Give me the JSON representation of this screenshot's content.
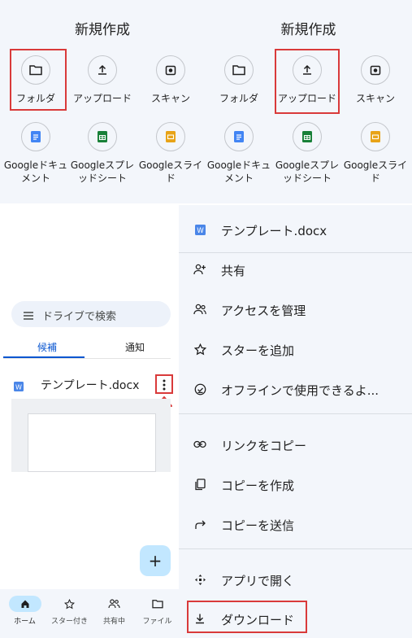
{
  "new_sheet": {
    "title": "新規作成",
    "options": [
      {
        "label": "フォルダ",
        "icon": "folder-icon"
      },
      {
        "label": "アップロード",
        "icon": "upload-icon"
      },
      {
        "label": "スキャン",
        "icon": "camera-icon"
      },
      {
        "label": "Googleドキュメント",
        "line1": "Googleドキュ",
        "line2": "メント",
        "icon": "google-docs-icon",
        "color": "#4285f4"
      },
      {
        "label": "Googleスプレッドシート",
        "line1": "Googleスプレ",
        "line2": "ッドシート",
        "icon": "google-sheets-icon",
        "color": "#188038"
      },
      {
        "label": "Googleスライド",
        "line1": "Googleスライ",
        "line2": "ド",
        "icon": "google-slides-icon",
        "color": "#e8a317"
      }
    ],
    "highlight_left": "フォルダ",
    "highlight_right": "アップロード"
  },
  "home": {
    "search_placeholder": "ドライブで検索",
    "tabs": [
      {
        "label": "候補",
        "active": true
      },
      {
        "label": "通知",
        "active": false
      }
    ],
    "file": {
      "name": "テンプレート.docx",
      "icon": "word-doc-icon"
    },
    "fab_label": "+",
    "bottom_nav": [
      {
        "label": "ホーム",
        "icon": "home-icon",
        "active": true
      },
      {
        "label": "スター付き",
        "icon": "star-icon",
        "active": false
      },
      {
        "label": "共有中",
        "icon": "people-icon",
        "active": false
      },
      {
        "label": "ファイル",
        "icon": "folder-icon",
        "active": false
      }
    ]
  },
  "menu": {
    "header": {
      "name": "テンプレート.docx",
      "icon": "word-doc-icon"
    },
    "items": [
      {
        "label": "共有",
        "icon": "person-add-icon"
      },
      {
        "label": "アクセスを管理",
        "icon": "manage-access-icon"
      },
      {
        "label": "スターを追加",
        "icon": "star-icon"
      },
      {
        "label": "オフラインで使用できるよ...",
        "icon": "offline-icon"
      },
      {
        "label": "リンクをコピー",
        "icon": "link-icon"
      },
      {
        "label": "コピーを作成",
        "icon": "copy-icon"
      },
      {
        "label": "コピーを送信",
        "icon": "send-icon"
      },
      {
        "label": "アプリで開く",
        "icon": "open-with-icon"
      },
      {
        "label": "ダウンロード",
        "icon": "download-icon"
      }
    ]
  },
  "colors": {
    "highlight": "#d93a3a",
    "accent": "#0b57d0",
    "panel_bg": "#f3f6fb",
    "fab_bg": "#c2e7ff"
  }
}
